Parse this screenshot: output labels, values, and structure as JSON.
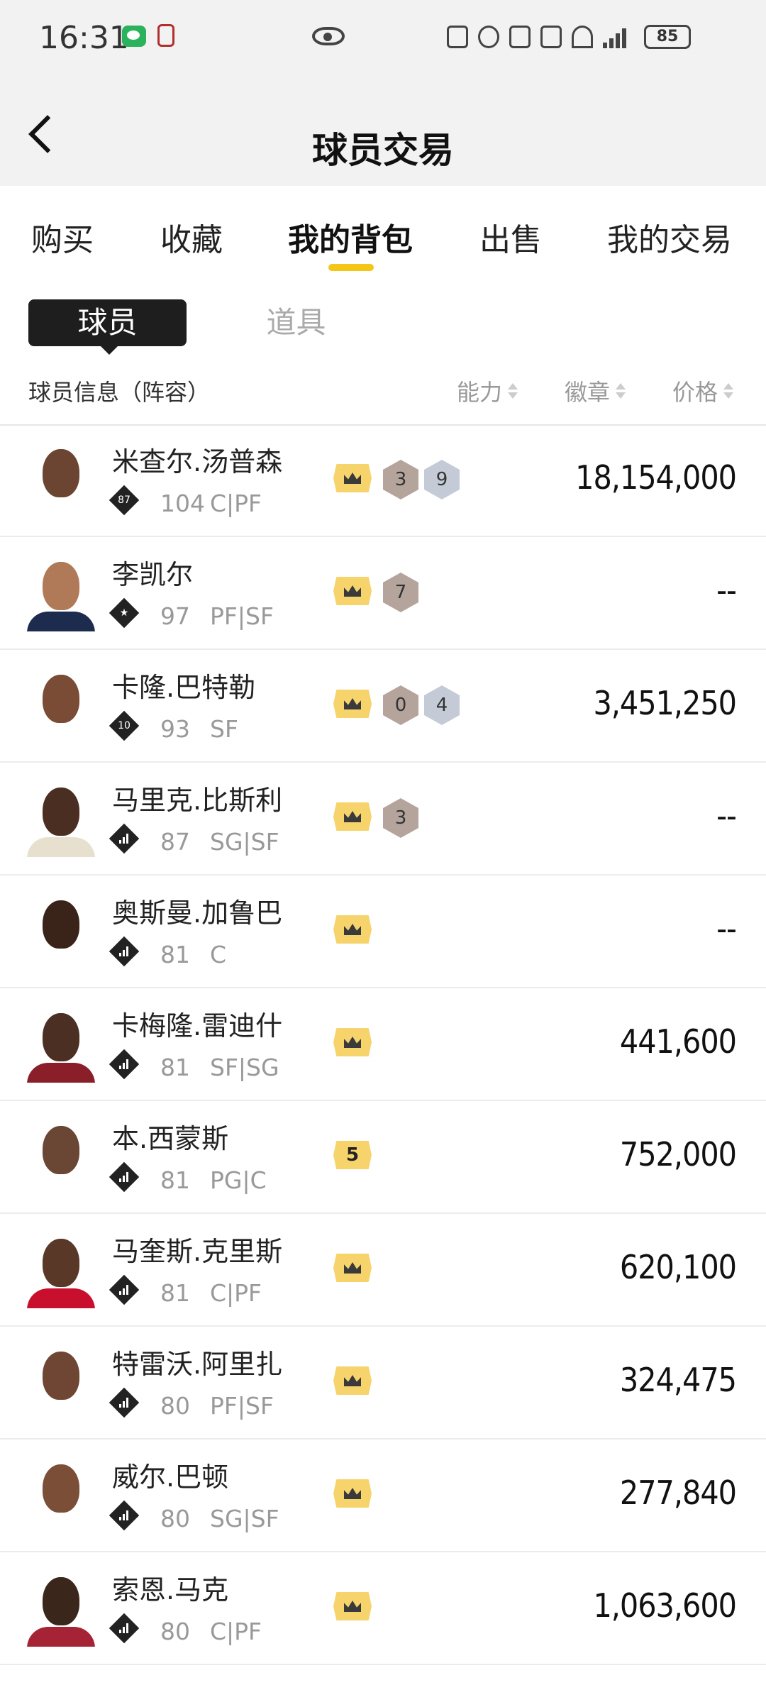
{
  "status_bar": {
    "time": "16:31",
    "battery": "85",
    "network": "4G"
  },
  "header": {
    "title": "球员交易"
  },
  "main_tabs": [
    {
      "label": "购买",
      "active": false
    },
    {
      "label": "收藏",
      "active": false
    },
    {
      "label": "我的背包",
      "active": true
    },
    {
      "label": "出售",
      "active": false
    },
    {
      "label": "我的交易",
      "active": false
    }
  ],
  "sub_tabs": {
    "active": "球员",
    "inactive": "道具"
  },
  "columns": {
    "info": "球员信息（阵容）",
    "ability": "能力",
    "badge": "徽章",
    "price": "价格"
  },
  "colors": {
    "accent": "#f5c518",
    "crown": "#f6d36b",
    "badge_bronze": "#b5a49c",
    "badge_silver": "#c5cbd6"
  },
  "players": [
    {
      "name": "米查尔.汤普森",
      "tier": "87",
      "rating": "104",
      "position": "C|PF",
      "crown": "crown-icon",
      "badges": [
        {
          "value": "3",
          "kind": "bronze"
        },
        {
          "value": "9",
          "kind": "silver"
        }
      ],
      "price": "18,154,000"
    },
    {
      "name": "李凯尔",
      "tier": "star",
      "rating": "97",
      "position": "PF|SF",
      "crown": "crown-icon",
      "badges": [
        {
          "value": "7",
          "kind": "bronze"
        }
      ],
      "price": "--"
    },
    {
      "name": "卡隆.巴特勒",
      "tier": "10",
      "rating": "93",
      "position": "SF",
      "crown": "crown-icon",
      "badges": [
        {
          "value": "0",
          "kind": "bronze"
        },
        {
          "value": "4",
          "kind": "silver"
        }
      ],
      "price": "3,451,250"
    },
    {
      "name": "马里克.比斯利",
      "tier": "bars",
      "rating": "87",
      "position": "SG|SF",
      "crown": "crown-icon",
      "badges": [
        {
          "value": "3",
          "kind": "bronze"
        }
      ],
      "price": "--"
    },
    {
      "name": "奥斯曼.加鲁巴",
      "tier": "bars",
      "rating": "81",
      "position": "C",
      "crown": "crown-icon",
      "badges": [],
      "price": "--"
    },
    {
      "name": "卡梅隆.雷迪什",
      "tier": "bars",
      "rating": "81",
      "position": "SF|SG",
      "crown": "crown-icon",
      "badges": [],
      "price": "441,600"
    },
    {
      "name": "本.西蒙斯",
      "tier": "bars",
      "rating": "81",
      "position": "PG|C",
      "crown": "5",
      "badges": [],
      "price": "752,000"
    },
    {
      "name": "马奎斯.克里斯",
      "tier": "bars",
      "rating": "81",
      "position": "C|PF",
      "crown": "crown-icon",
      "badges": [],
      "price": "620,100"
    },
    {
      "name": "特雷沃.阿里扎",
      "tier": "bars",
      "rating": "80",
      "position": "PF|SF",
      "crown": "crown-icon",
      "badges": [],
      "price": "324,475"
    },
    {
      "name": "威尔.巴顿",
      "tier": "bars",
      "rating": "80",
      "position": "SG|SF",
      "crown": "crown-icon",
      "badges": [],
      "price": "277,840"
    },
    {
      "name": "索恩.马克",
      "tier": "bars",
      "rating": "80",
      "position": "C|PF",
      "crown": "crown-icon",
      "badges": [],
      "price": "1,063,600"
    }
  ]
}
